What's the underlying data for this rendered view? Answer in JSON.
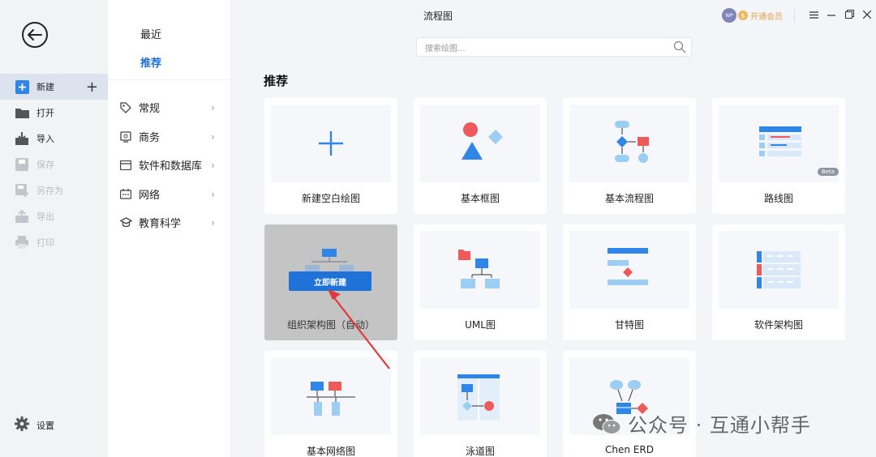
{
  "sidebar": {
    "items": [
      {
        "label": "新建",
        "icon": "plus-square-icon",
        "active": true
      },
      {
        "label": "打开",
        "icon": "folder-icon"
      },
      {
        "label": "导入",
        "icon": "import-icon"
      },
      {
        "label": "保存",
        "icon": "save-icon",
        "disabled": true
      },
      {
        "label": "另存为",
        "icon": "save-as-icon",
        "disabled": true
      },
      {
        "label": "导出",
        "icon": "export-icon",
        "disabled": true
      },
      {
        "label": "打印",
        "icon": "printer-icon",
        "disabled": true
      }
    ],
    "settings_label": "设置"
  },
  "nav": {
    "recent": "最近",
    "recommend": "推荐",
    "categories": [
      {
        "label": "常规",
        "icon": "tag-icon"
      },
      {
        "label": "商务",
        "icon": "business-icon"
      },
      {
        "label": "软件和数据库",
        "icon": "window-icon"
      },
      {
        "label": "网络",
        "icon": "network-icon"
      },
      {
        "label": "教育科学",
        "icon": "graduation-cap-icon"
      }
    ]
  },
  "header": {
    "title": "流程图",
    "search_placeholder": "搜索绘图...",
    "avatar_text": "WP",
    "vip_label": "开通会员"
  },
  "main": {
    "section_title": "推荐",
    "templates": [
      {
        "label": "新建空白绘图"
      },
      {
        "label": "基本框图"
      },
      {
        "label": "基本流程图"
      },
      {
        "label": "路线图",
        "badge": "Beta"
      },
      {
        "label": "组织架构图（自动）",
        "hover_button": "立即新建"
      },
      {
        "label": "UML图"
      },
      {
        "label": "甘特图"
      },
      {
        "label": "软件架构图"
      },
      {
        "label": "基本网络图"
      },
      {
        "label": "泳道图"
      },
      {
        "label": "Chen ERD"
      }
    ]
  },
  "watermark": "公众号 · 互通小帮手",
  "colors": {
    "accent": "#1d6fd8",
    "red": "#ee5a5a",
    "blue": "#2f86e8"
  }
}
